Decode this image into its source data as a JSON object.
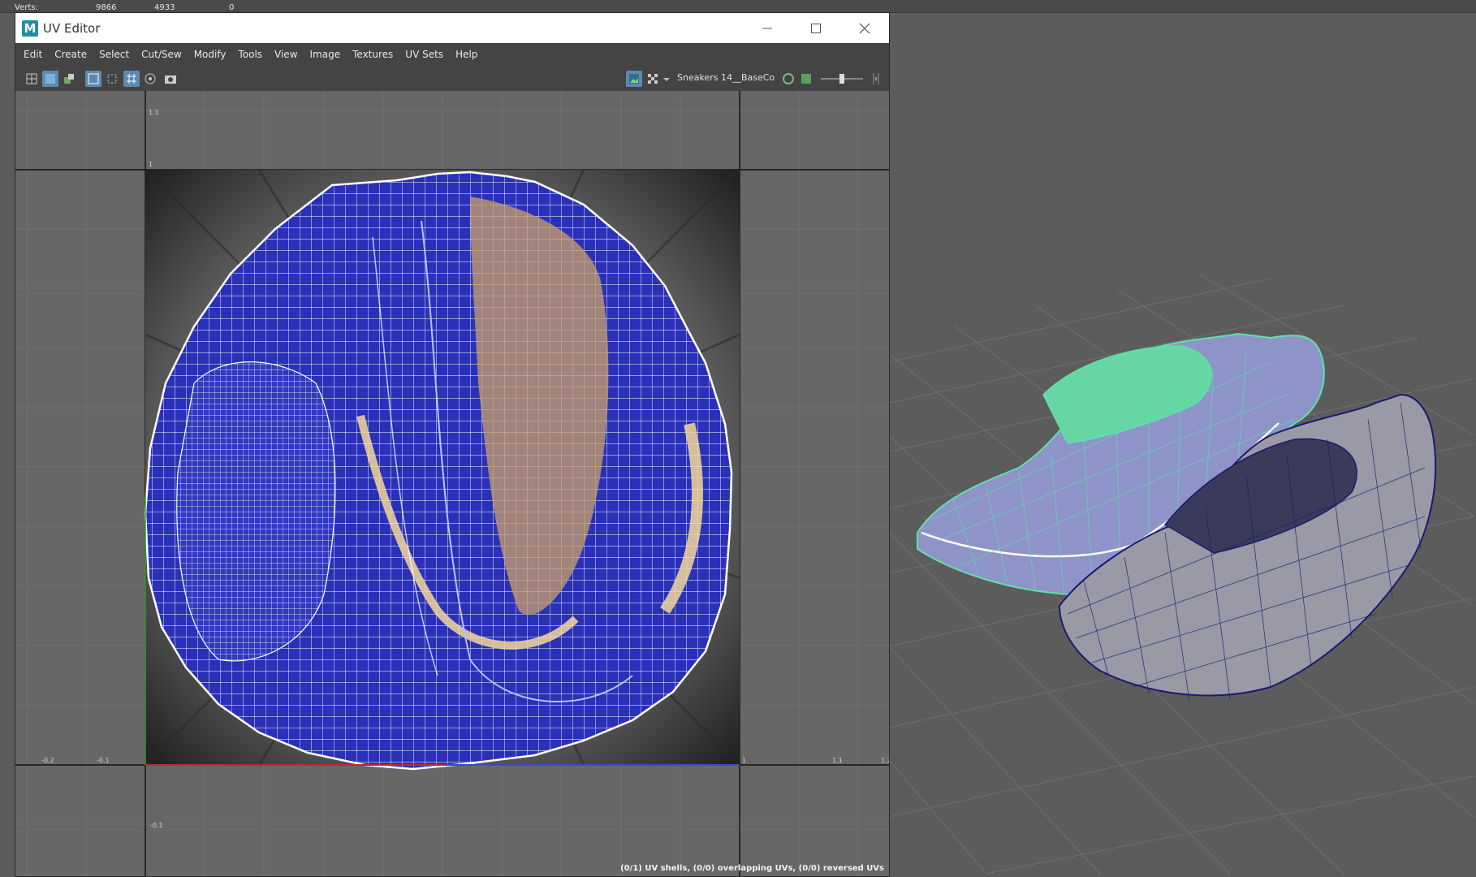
{
  "hud": {
    "verts_label": "Verts:",
    "verts_values": [
      "9866",
      "4933",
      "0"
    ]
  },
  "window": {
    "app_icon": "M",
    "title": "UV Editor"
  },
  "menu": [
    "Edit",
    "Create",
    "Select",
    "Cut/Sew",
    "Modify",
    "Tools",
    "View",
    "Image",
    "Textures",
    "UV Sets",
    "Help"
  ],
  "toolbar": {
    "texture_name": "Sneakers 14__BaseCo"
  },
  "uv_grid": {
    "tick_labels": {
      "top": "1.1",
      "left_unit": "1",
      "x_neg02": "-0.2",
      "x_neg01": "-0.1",
      "x_1": "1",
      "x_11": "1.1",
      "x_12": "1.2",
      "y_neg01": "-0.1"
    }
  },
  "status": {
    "text": "(0/1) UV shells, (0/0) overlapping UVs, (0/0) reversed UVs"
  },
  "colors": {
    "uv_fill": "#2a30b8",
    "wire": "#ffffff",
    "selected_shoe": "#5de2a8",
    "shoe_wire": "#1a1a70",
    "grid": "#7a7a7a"
  }
}
